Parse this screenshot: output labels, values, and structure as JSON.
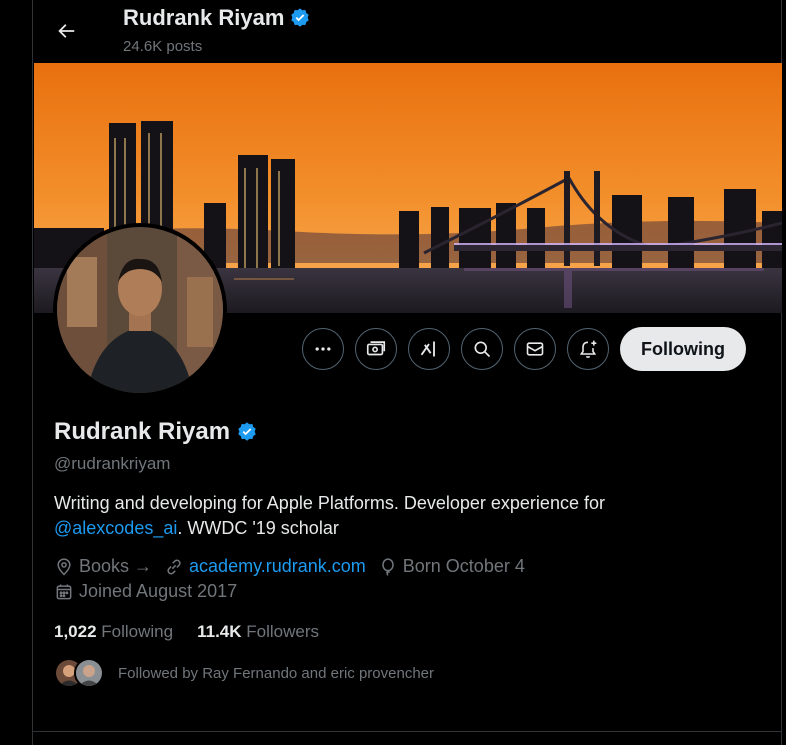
{
  "header": {
    "name": "Rudrank Riyam",
    "posts": "24.6K posts"
  },
  "profile": {
    "name": "Rudrank Riyam",
    "handle": "@rudrankriyam",
    "bio_line1": "Writing and developing for Apple Platforms. Developer experience for",
    "bio_mention": "@alexcodes_ai",
    "bio_rest": ". WWDC '19 scholar",
    "location": "Books →",
    "website": "academy.rudrank.com",
    "birthday": "Born October 4",
    "joined": "Joined August 2017",
    "following_count": "1,022",
    "following_label": "Following",
    "followers_count": "11.4K",
    "followers_label": "Followers",
    "followed_by": "Followed by Ray Fernando and eric provencher"
  },
  "actions": {
    "more_icon": "more-icon",
    "tips_icon": "money-icon",
    "grok_icon": "grok-icon",
    "search_icon": "search-icon",
    "message_icon": "mail-icon",
    "notify_icon": "bell-plus-icon",
    "following_button": "Following"
  },
  "colors": {
    "accent": "#1d9bf0",
    "bg": "#000000",
    "muted": "#71767b",
    "text": "#e7e9ea",
    "verified": "#1d9bf0"
  }
}
